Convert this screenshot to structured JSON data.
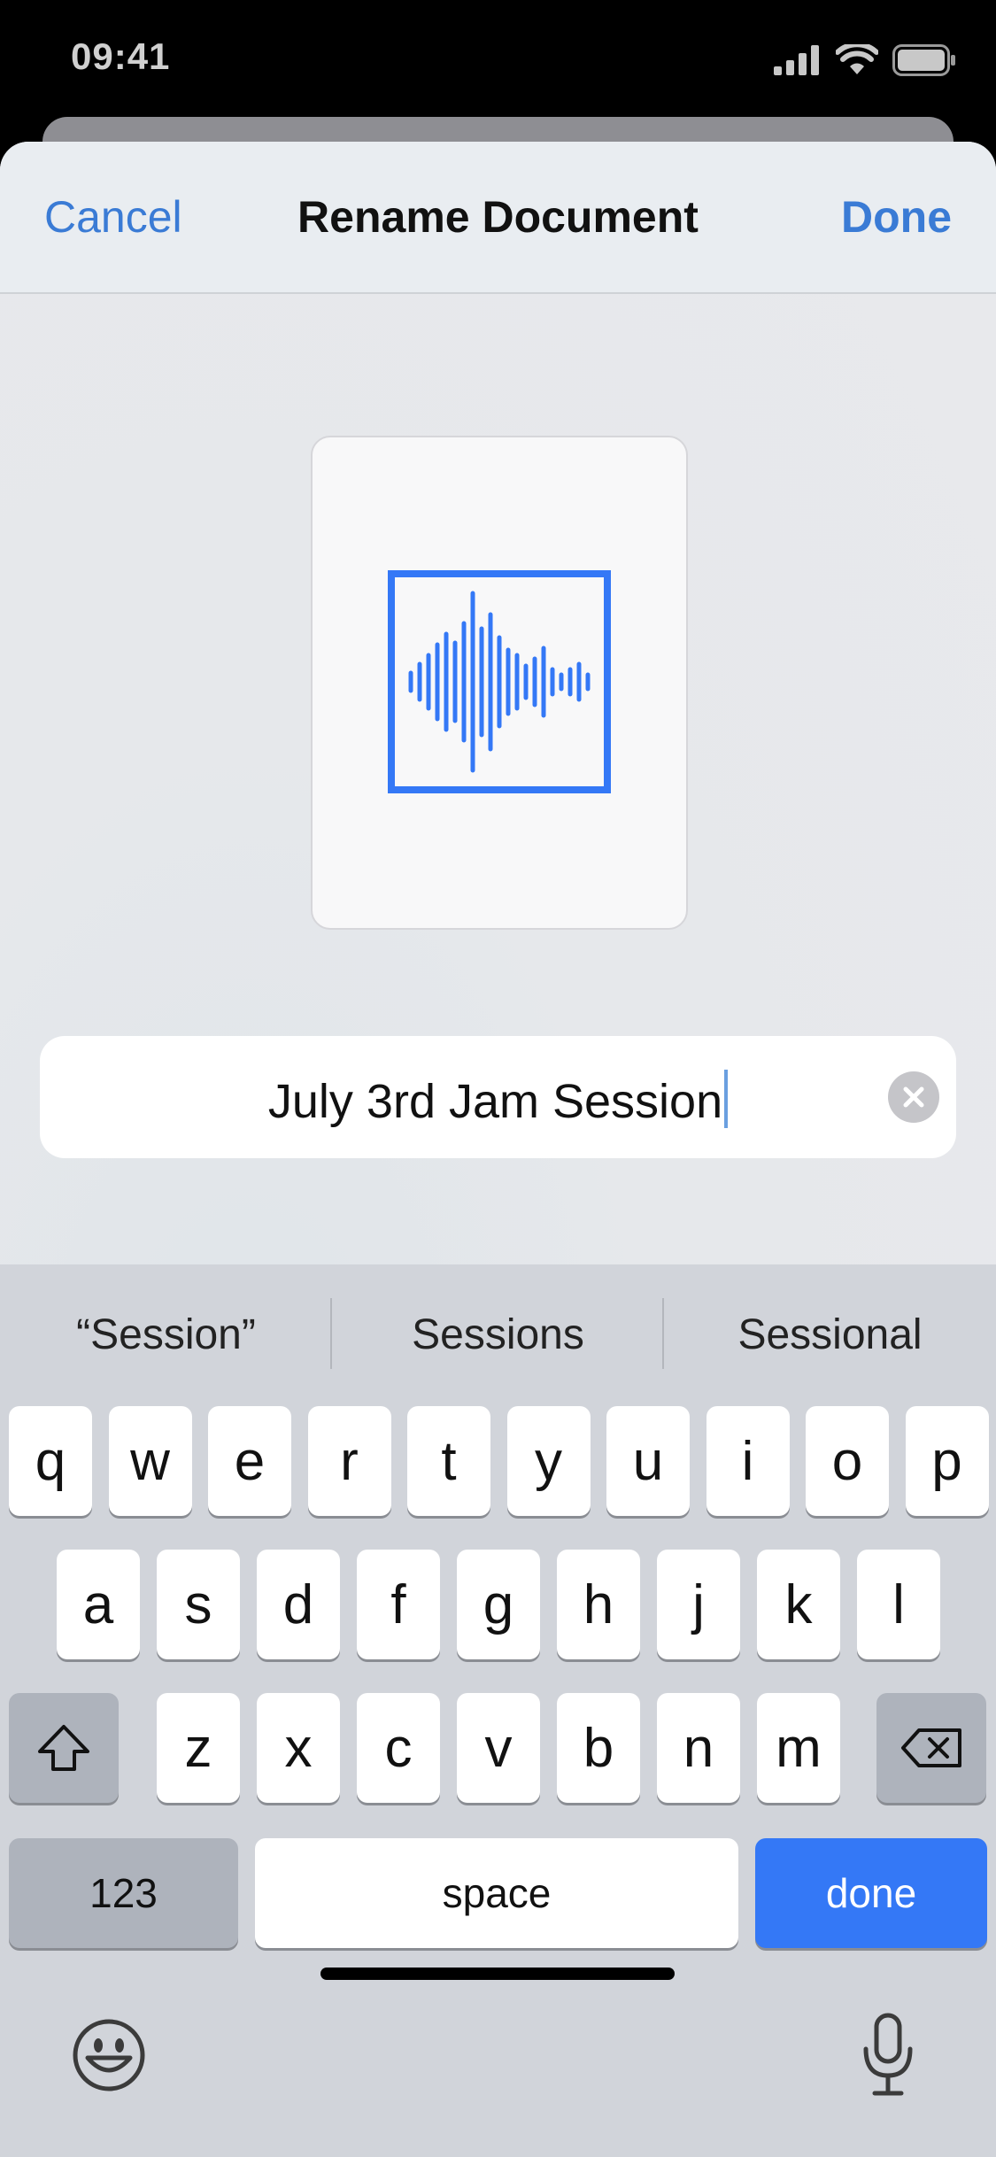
{
  "status": {
    "time": "09:41"
  },
  "nav": {
    "cancel_label": "Cancel",
    "title": "Rename Document",
    "done_label": "Done"
  },
  "document": {
    "icon": "waveform-icon",
    "name": "July 3rd Jam Session"
  },
  "suggestions": [
    "“Session”",
    "Sessions",
    "Sessional"
  ],
  "keyboard": {
    "row1": [
      "q",
      "w",
      "e",
      "r",
      "t",
      "y",
      "u",
      "i",
      "o",
      "p"
    ],
    "row2": [
      "a",
      "s",
      "d",
      "f",
      "g",
      "h",
      "j",
      "k",
      "l"
    ],
    "row3": [
      "z",
      "x",
      "c",
      "v",
      "b",
      "n",
      "m"
    ],
    "numbers_label": "123",
    "space_label": "space",
    "done_label": "done"
  },
  "colors": {
    "accent": "#3a7bd5",
    "keyboard_done": "#3478f6",
    "keyboard_bg": "#d1d4da"
  }
}
